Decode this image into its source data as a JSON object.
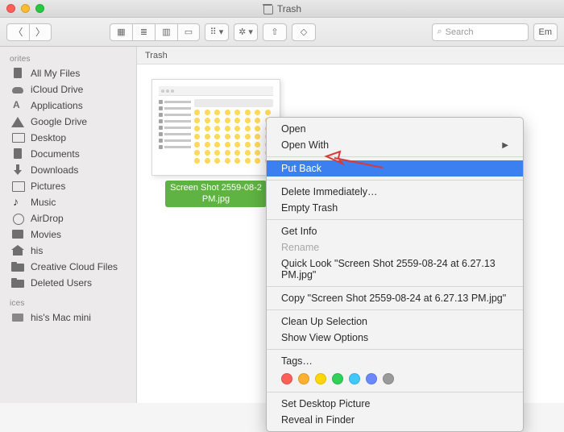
{
  "titlebar": {
    "title": "Trash"
  },
  "toolbar": {
    "search_placeholder": "Search",
    "empty_label": "Em"
  },
  "pathbar": {
    "location": "Trash"
  },
  "sidebar": {
    "headers": {
      "favorites": "orites",
      "devices": "ices"
    },
    "items": [
      {
        "icon": "docfile",
        "label": "All My Files"
      },
      {
        "icon": "cloud",
        "label": "iCloud Drive"
      },
      {
        "icon": "a-icon",
        "label": "Applications"
      },
      {
        "icon": "gdrive",
        "label": "Google Drive"
      },
      {
        "icon": "desktop",
        "label": "Desktop"
      },
      {
        "icon": "docfile",
        "label": "Documents"
      },
      {
        "icon": "dlarrow",
        "label": "Downloads"
      },
      {
        "icon": "pict",
        "label": "Pictures"
      },
      {
        "icon": "music",
        "label": "Music"
      },
      {
        "icon": "airdrop",
        "label": "AirDrop"
      },
      {
        "icon": "movies",
        "label": "Movies"
      },
      {
        "icon": "home",
        "label": "his"
      },
      {
        "icon": "folder",
        "label": "Creative Cloud Files"
      },
      {
        "icon": "folder",
        "label": "Deleted Users"
      }
    ],
    "devices": [
      {
        "icon": "disk",
        "label": "his's Mac mini"
      }
    ]
  },
  "content": {
    "file": {
      "name_line1": "Screen Shot 2559-08-2",
      "name_line2": "PM.jpg"
    }
  },
  "context_menu": {
    "open": "Open",
    "open_with": "Open With",
    "put_back": "Put Back",
    "delete_immediately": "Delete Immediately…",
    "empty_trash": "Empty Trash",
    "get_info": "Get Info",
    "rename": "Rename",
    "quick_look": "Quick Look \"Screen Shot 2559-08-24 at 6.27.13 PM.jpg\"",
    "copy": "Copy \"Screen Shot 2559-08-24 at 6.27.13 PM.jpg\"",
    "clean_up": "Clean Up Selection",
    "show_view_options": "Show View Options",
    "tags": "Tags…",
    "tag_colors": [
      "#ff5f57",
      "#ffb02e",
      "#ffd60a",
      "#30d158",
      "#40c8ff",
      "#6a88ff",
      "#9a9a9a"
    ],
    "set_desktop": "Set Desktop Picture",
    "reveal": "Reveal in Finder"
  },
  "colors": {
    "traffic": {
      "close": "#ff5f57",
      "min": "#ffbd2e",
      "max": "#28c940"
    }
  }
}
